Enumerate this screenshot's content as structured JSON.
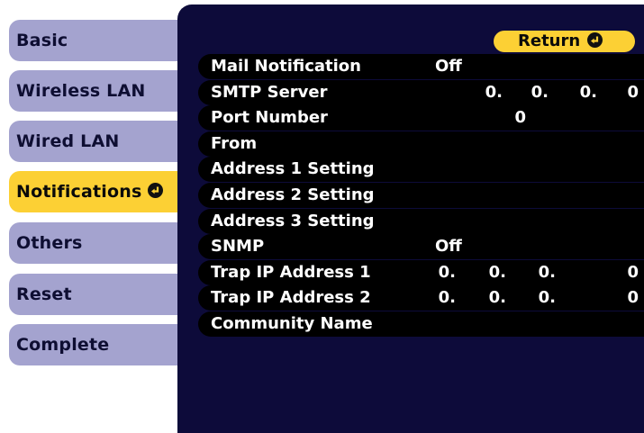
{
  "sidebar": {
    "items": [
      {
        "label": "Basic"
      },
      {
        "label": "Wireless LAN"
      },
      {
        "label": "Wired LAN"
      },
      {
        "label": "Notifications",
        "active": true
      },
      {
        "label": "Others"
      },
      {
        "label": "Reset"
      },
      {
        "label": "Complete"
      }
    ]
  },
  "return_label": "Return",
  "settings": {
    "mail_notification": {
      "label": "Mail Notification",
      "value": "Off"
    },
    "smtp_server": {
      "label": "SMTP Server",
      "octets": [
        "0.",
        "0.",
        "0.",
        "0"
      ]
    },
    "port_number": {
      "label": "Port Number",
      "value": "0"
    },
    "from": {
      "label": "From"
    },
    "address1": {
      "label": "Address 1 Setting"
    },
    "address2": {
      "label": "Address 2 Setting"
    },
    "address3": {
      "label": "Address 3 Setting"
    },
    "snmp": {
      "label": "SNMP",
      "value": "Off"
    },
    "trap1": {
      "label": "Trap IP Address 1",
      "octets": [
        "0.",
        "0.",
        "0.",
        "0"
      ]
    },
    "trap2": {
      "label": "Trap IP Address 2",
      "octets": [
        "0.",
        "0.",
        "0.",
        "0"
      ]
    },
    "community": {
      "label": "Community Name"
    }
  },
  "colors": {
    "tab": "#a4a3cf",
    "tab_active": "#fcd034",
    "panel": "#0d0b3a",
    "row": "#000000"
  },
  "icons": {
    "enter": "enter-icon"
  }
}
